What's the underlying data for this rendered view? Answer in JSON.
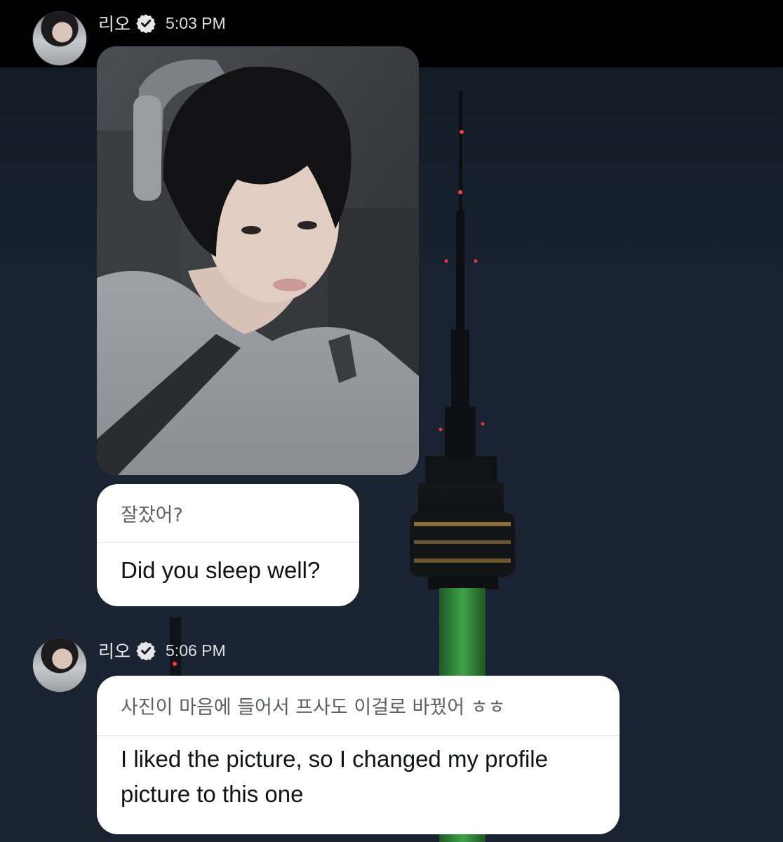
{
  "messages": [
    {
      "sender_name": "리오",
      "time": "5:03 PM",
      "photo_attachment": true,
      "korean_text": "잘잤어?",
      "english_text": "Did you sleep well?"
    },
    {
      "sender_name": "리오",
      "time": "5:06 PM",
      "korean_text": "사진이 마음에 들어서 프사도 이걸로 바꿨어 ㅎㅎ",
      "english_text_line1": "I liked the picture, so I changed my profile",
      "english_text_line2": "picture to this one"
    }
  ],
  "icons": {
    "verified": "verified-check-icon"
  },
  "colors": {
    "background": "#182230",
    "bubble": "#ffffff",
    "tower_light": "#3ea24a"
  }
}
